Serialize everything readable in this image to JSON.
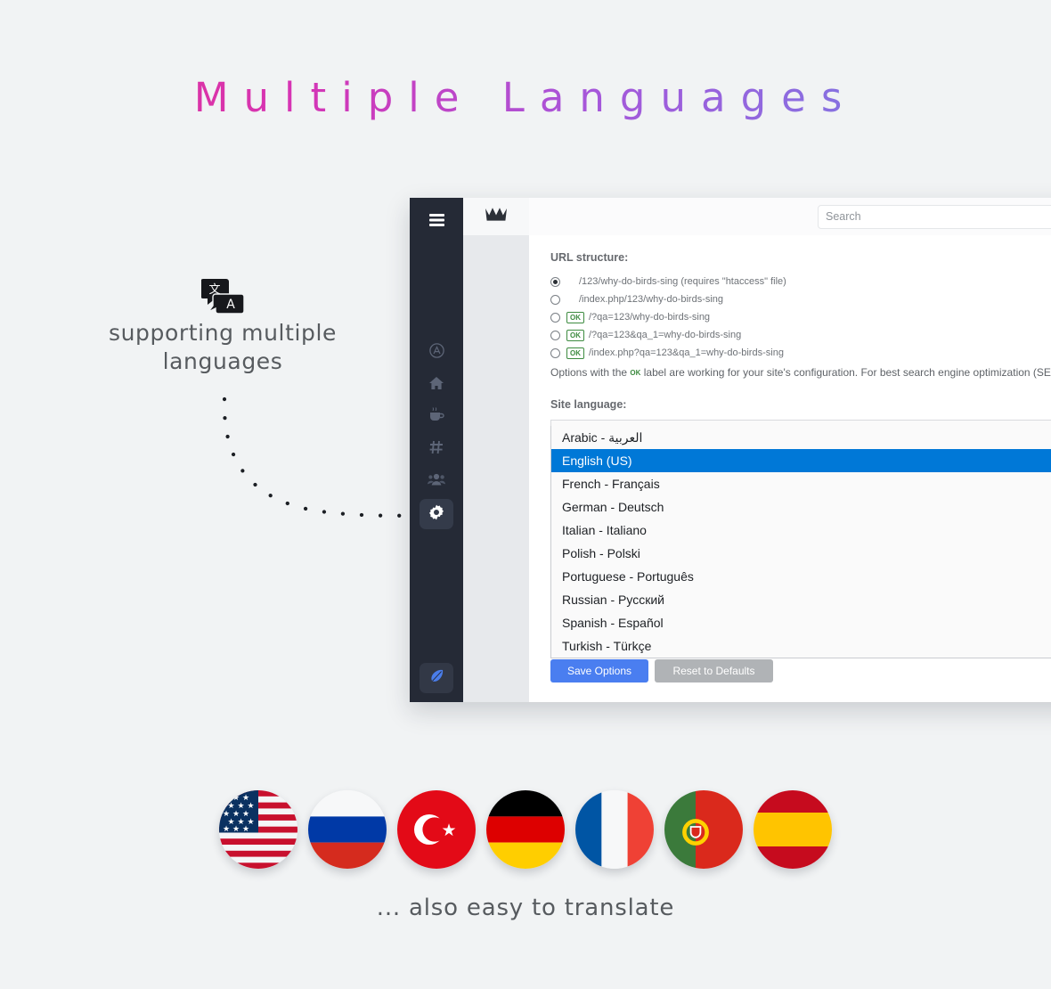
{
  "hero": {
    "title": "Multiple Languages",
    "gradient_start": "#e3318e",
    "gradient_end": "#6d8ae0"
  },
  "annotations": {
    "left": "supporting multiple languages",
    "left_line1": "supporting multiple",
    "left_line2": "languages",
    "bottom": "... also easy to translate",
    "translate_icon_glyph_1": "文",
    "translate_icon_glyph_2": "A"
  },
  "app": {
    "sidebar": {
      "icons": [
        {
          "name": "hamburger-menu-icon",
          "label": "Menu"
        },
        {
          "name": "circle-a-icon",
          "label": "Account"
        },
        {
          "name": "home-icon",
          "label": "Home"
        },
        {
          "name": "coffee-cup-icon",
          "label": "Coffee"
        },
        {
          "name": "hashtag-icon",
          "label": "Tags"
        },
        {
          "name": "users-icon",
          "label": "Users"
        },
        {
          "name": "gear-icon",
          "label": "Settings",
          "active": true
        },
        {
          "name": "feather-icon",
          "label": "Compose"
        }
      ]
    },
    "subcolumn": {
      "crown_icon": "crown-icon"
    },
    "search": {
      "placeholder": "Search",
      "value": "",
      "icon": "search-icon"
    },
    "url_structure": {
      "label": "URL structure:",
      "options": [
        {
          "text": "/123/why-do-birds-sing (requires \"htaccess\" file)",
          "checked": true,
          "ok": false
        },
        {
          "text": "/index.php/123/why-do-birds-sing",
          "checked": false,
          "ok": false
        },
        {
          "text": "/?qa=123/why-do-birds-sing",
          "checked": false,
          "ok": true
        },
        {
          "text": "/?qa=123&qa_1=why-do-birds-sing",
          "checked": false,
          "ok": true
        },
        {
          "text": "/index.php?qa=123&qa_1=why-do-birds-sing",
          "checked": false,
          "ok": true
        }
      ],
      "ok_badge_label": "OK",
      "note_part1": "Options with the",
      "note_ok": "OK",
      "note_part2": "label are working for your site's configuration. For best search engine optimization (SEO), use t"
    },
    "site_language": {
      "label": "Site language:",
      "selected": "English (US)",
      "options": [
        "Arabic - العربية",
        "English (US)",
        "French - Français",
        "German - Deutsch",
        "Italian - Italiano",
        "Polish - Polski",
        "Portuguese - Português",
        "Russian - Русский",
        "Spanish - Español",
        "Turkish - Türkçe"
      ],
      "highlight_color": "#0078d7"
    },
    "buttons": {
      "save": "Save Options",
      "reset": "Reset to Defaults",
      "save_color": "#4a7ef0",
      "reset_color": "#b0b3b6"
    }
  },
  "flags": [
    {
      "name": "flag-united-states",
      "label": "United States"
    },
    {
      "name": "flag-russia",
      "label": "Russia"
    },
    {
      "name": "flag-turkey",
      "label": "Turkey"
    },
    {
      "name": "flag-germany",
      "label": "Germany"
    },
    {
      "name": "flag-france",
      "label": "France"
    },
    {
      "name": "flag-portugal",
      "label": "Portugal"
    },
    {
      "name": "flag-spain",
      "label": "Spain"
    }
  ]
}
